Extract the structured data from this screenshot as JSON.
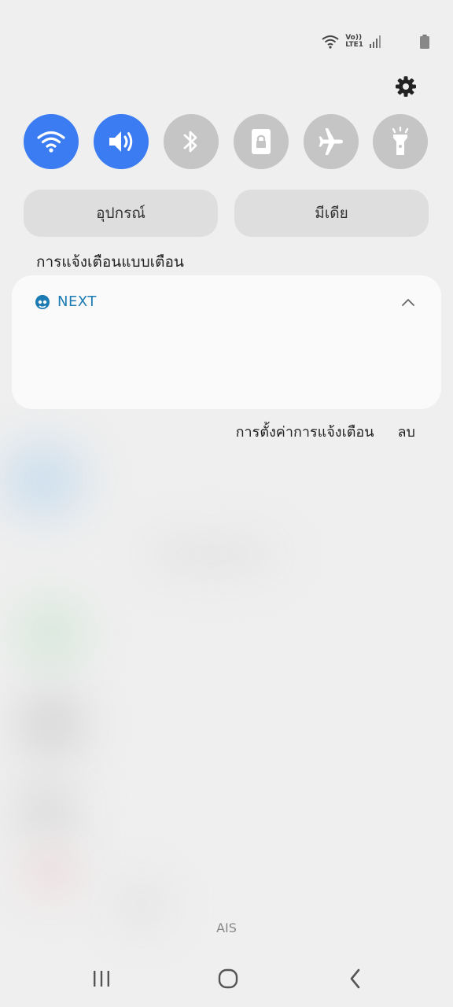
{
  "quick_settings": {
    "tiles": [
      {
        "icon": "wifi-icon",
        "state": "on"
      },
      {
        "icon": "sound-icon",
        "state": "on"
      },
      {
        "icon": "bluetooth-icon",
        "state": "off"
      },
      {
        "icon": "portrait-lock-icon",
        "state": "off"
      },
      {
        "icon": "airplane-icon",
        "state": "off"
      },
      {
        "icon": "flashlight-icon",
        "state": "off"
      }
    ],
    "devices_label": "อุปกรณ์",
    "media_label": "มีเดีย"
  },
  "status_bar": {
    "volte_label_top": "Vo))",
    "volte_label_bottom": "LTE1"
  },
  "notifications": {
    "section_label": "การแจ้งเตือนแบบเตือน",
    "card": {
      "app_name": "NEXT"
    },
    "settings_label": "การตั้งค่าการแจ้งเตือน",
    "clear_label": "ลบ"
  },
  "carrier": "AIS",
  "colors": {
    "tile_on": "#3b7cf3",
    "tile_off": "#c5c5c5",
    "app_accent": "#1c7bb3"
  }
}
